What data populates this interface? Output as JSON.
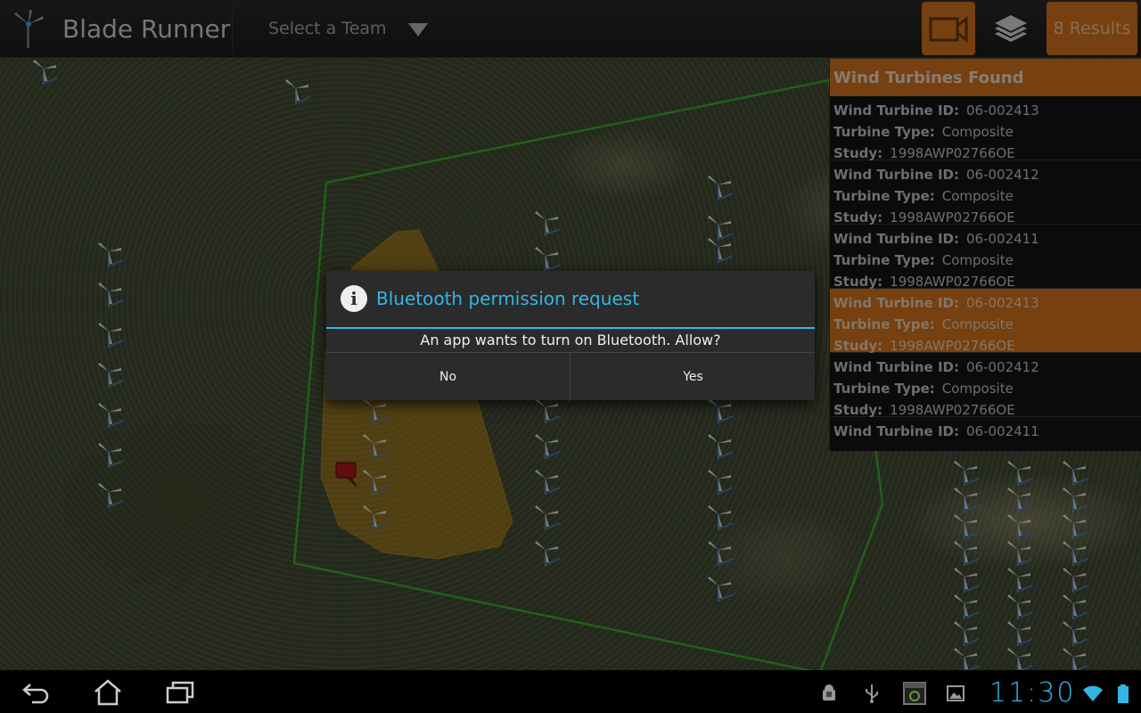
{
  "app": {
    "title": "Blade Runner",
    "accent_color": "#d8761e",
    "holo_blue": "#33b5e5"
  },
  "actionbar": {
    "team_select": {
      "label": "Select a Team"
    },
    "camera_button_icon": "video-camera-icon",
    "layers_button_icon": "layers-icon",
    "results_button_label": "8 Results"
  },
  "results_panel": {
    "header": "Wind Turbines Found",
    "field_labels": {
      "id": "Wind Turbine ID:",
      "type": "Turbine Type:",
      "study": "Study:"
    },
    "items": [
      {
        "id": "06-002413",
        "type": "Composite",
        "study": "1998AWP02766OE",
        "selected": false
      },
      {
        "id": "06-002412",
        "type": "Composite",
        "study": "1998AWP02766OE",
        "selected": false
      },
      {
        "id": "06-002411",
        "type": "Composite",
        "study": "1998AWP02766OE",
        "selected": false
      },
      {
        "id": "06-002413",
        "type": "Composite",
        "study": "1998AWP02766OE",
        "selected": true
      },
      {
        "id": "06-002412",
        "type": "Composite",
        "study": "1998AWP02766OE",
        "selected": false
      },
      {
        "id": "06-002411"
      }
    ]
  },
  "dialog": {
    "icon": "info-icon",
    "title": "Bluetooth permission request",
    "message": "An app wants to turn on Bluetooth. Allow?",
    "no_label": "No",
    "yes_label": "Yes"
  },
  "navbar": {
    "icons": [
      "back-icon",
      "home-icon",
      "recent-apps-icon"
    ],
    "status_icons": [
      "android-debug-icon",
      "usb-icon",
      "screenshot-icon",
      "gallery-icon",
      "wifi-icon",
      "battery-icon"
    ],
    "clock": "11:30"
  }
}
